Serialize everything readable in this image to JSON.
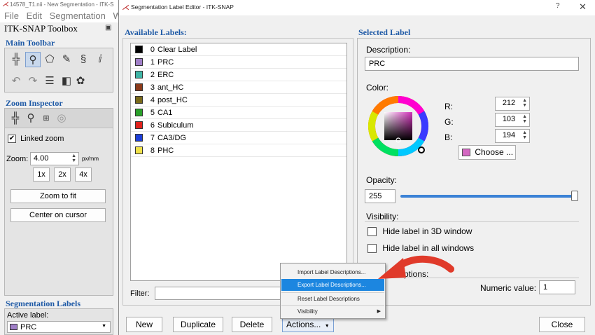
{
  "bg_window": {
    "title": "14578_T1.nii - New Segmentation - ITK-S",
    "menu": [
      "File",
      "Edit",
      "Segmentation",
      "W"
    ],
    "toolbox_title": "ITK-SNAP Toolbox",
    "main_toolbar_title": "Main Toolbar",
    "zoom_inspector_title": "Zoom Inspector",
    "linked_zoom": "Linked zoom",
    "zoom_label": "Zoom:",
    "zoom_value": "4.00",
    "zoom_unit": "px/mm",
    "zoom_1x": "1x",
    "zoom_2x": "2x",
    "zoom_4x": "4x",
    "zoom_to_fit": "Zoom to fit",
    "center_on_cursor": "Center on cursor",
    "seg_labels_title": "Segmentation Labels",
    "active_label": "Active label:",
    "active_label_value": "PRC",
    "active_label_color": "#a07fc8"
  },
  "dialog": {
    "title": "Segmentation Label Editor - ITK-SNAP",
    "help": "?",
    "close_x": "✕",
    "available_title": "Available Labels:",
    "labels": [
      {
        "num": "0",
        "name": "Clear Label",
        "color": "#000000"
      },
      {
        "num": "1",
        "name": "PRC",
        "color": "#a07fc8"
      },
      {
        "num": "2",
        "name": "ERC",
        "color": "#3fb5a6"
      },
      {
        "num": "3",
        "name": "ant_HC",
        "color": "#8b3a1a"
      },
      {
        "num": "4",
        "name": "post_HC",
        "color": "#7a6a1a"
      },
      {
        "num": "5",
        "name": "CA1",
        "color": "#2aa02a"
      },
      {
        "num": "6",
        "name": "Subiculum",
        "color": "#e0221c"
      },
      {
        "num": "7",
        "name": "CA3/DG",
        "color": "#1c3ed8"
      },
      {
        "num": "8",
        "name": "PHC",
        "color": "#f0e24a"
      }
    ],
    "filter_label": "Filter:",
    "buttons": {
      "new": "New",
      "duplicate": "Duplicate",
      "delete": "Delete",
      "actions": "Actions...",
      "close": "Close"
    },
    "selected_title": "Selected Label",
    "description_label": "Description:",
    "description_value": "PRC",
    "color_label": "Color:",
    "r_label": "R:",
    "r_value": "212",
    "g_label": "G:",
    "g_value": "103",
    "b_label": "B:",
    "b_value": "194",
    "choose": "Choose ...",
    "choose_swatch": "#d467c2",
    "opacity_label": "Opacity:",
    "opacity_value": "255",
    "opacity_fraction": 1.0,
    "visibility_label": "Visibility:",
    "hide_3d": "Hide label in 3D window",
    "hide_all": "Hide label in all windows",
    "options_label": "ptions:",
    "numeric_label": "Numeric value:",
    "numeric_value": "1",
    "accent": "#1f5aa6"
  },
  "actions_menu": [
    {
      "label": "Import Label Descriptions..."
    },
    {
      "label": "Export Label Descriptions..."
    },
    {
      "label": "Reset Label Descriptions"
    },
    {
      "label": "Visibility"
    }
  ]
}
